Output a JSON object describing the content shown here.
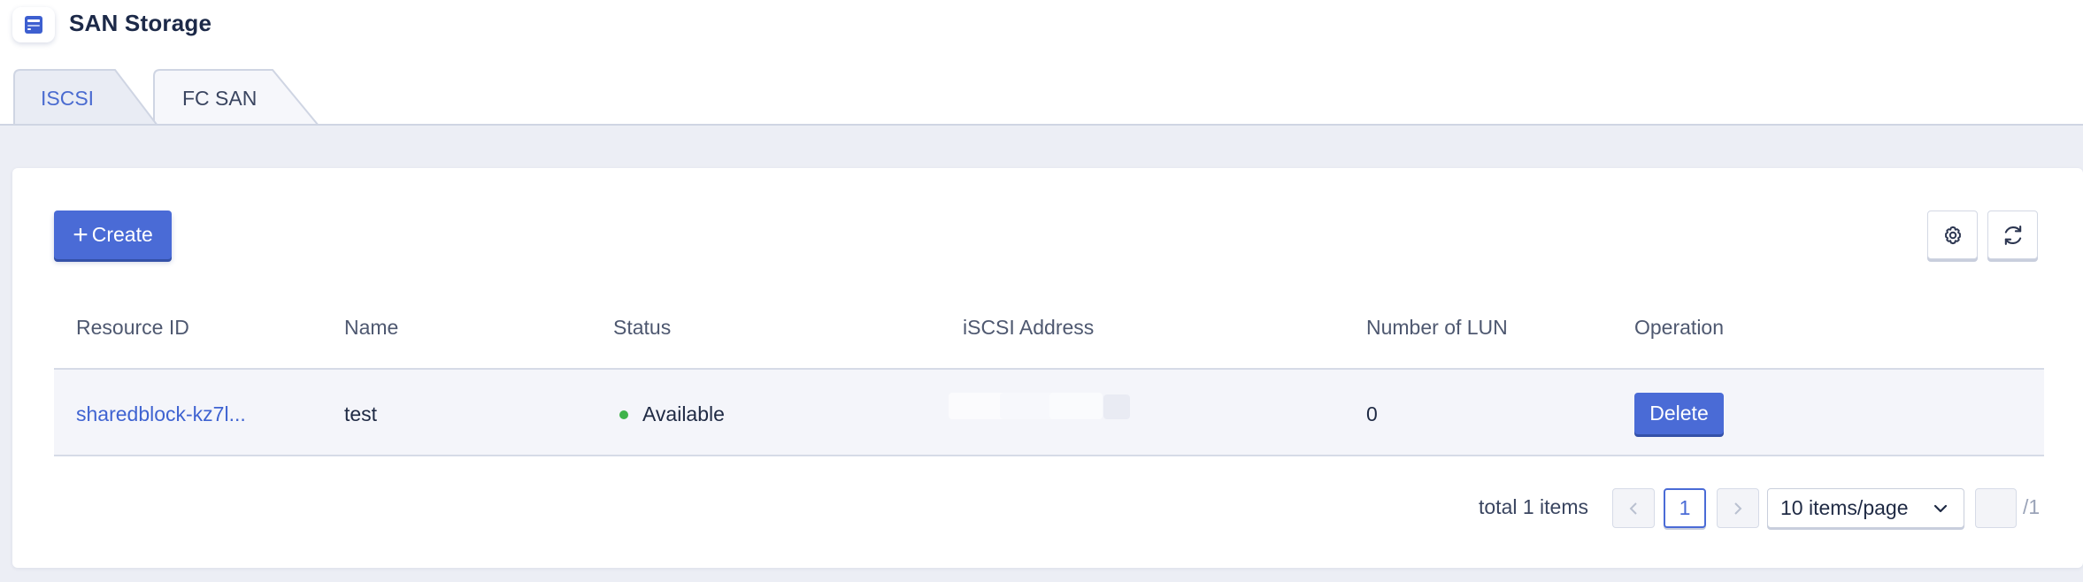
{
  "app": {
    "title": "SAN Storage",
    "icon": "storage-icon"
  },
  "tabs": [
    {
      "label": "ISCSI",
      "active": true
    },
    {
      "label": "FC SAN",
      "active": false
    }
  ],
  "toolbar": {
    "create_label": "Create",
    "settings_icon": "gear-icon",
    "refresh_icon": "refresh-icon"
  },
  "table": {
    "columns": [
      "Resource ID",
      "Name",
      "Status",
      "iSCSI Address",
      "Number of LUN",
      "Operation"
    ],
    "rows": [
      {
        "resource_id": "sharedblock-kz7l...",
        "name": "test",
        "status": "Available",
        "status_color": "#3eb34a",
        "iscsi_address": "",
        "lun_count": "0",
        "operation": "Delete"
      }
    ]
  },
  "pagination": {
    "total_text": "total 1 items",
    "prev": "<",
    "current_page": "1",
    "next": ">",
    "page_size": "10 items/page",
    "jump_value": "",
    "total_pages": "/1"
  },
  "colors": {
    "accent": "#4a6bd6",
    "link": "#3f63d1",
    "content_bg": "#eceef5",
    "status_available": "#3eb34a"
  }
}
